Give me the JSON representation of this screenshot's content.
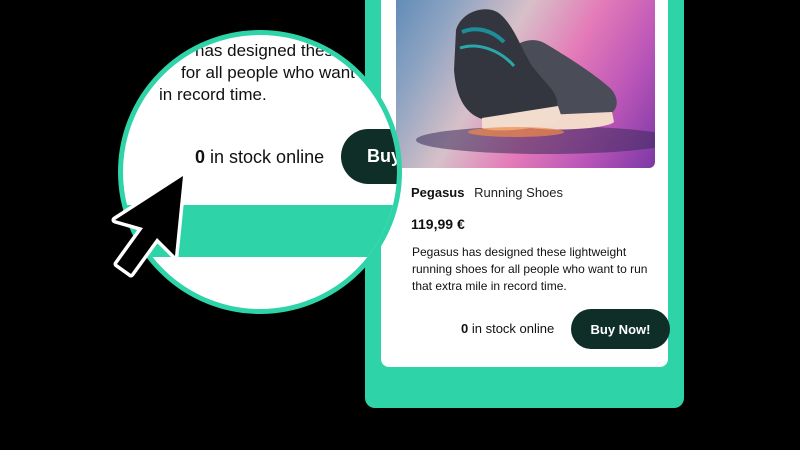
{
  "product": {
    "brand": "Pegasus",
    "category": "Running Shoes",
    "price": "119,99 €",
    "description": "Pegasus has designed these lightweight running shoes for all people who want to run that extra mile in record time.",
    "stock_count": "0",
    "stock_label": "in stock online",
    "buy_label": "Buy Now!",
    "image_icon": "sneaker-image"
  },
  "magnifier": {
    "line1": "has designed these",
    "line2": "for all people who want t",
    "line3": "in record time.",
    "stock_count": "0",
    "stock_label": "in stock online",
    "buy_label": "Buy"
  },
  "colors": {
    "accent": "#2ed3a7",
    "button": "#0e2e27",
    "background": "#000000"
  }
}
